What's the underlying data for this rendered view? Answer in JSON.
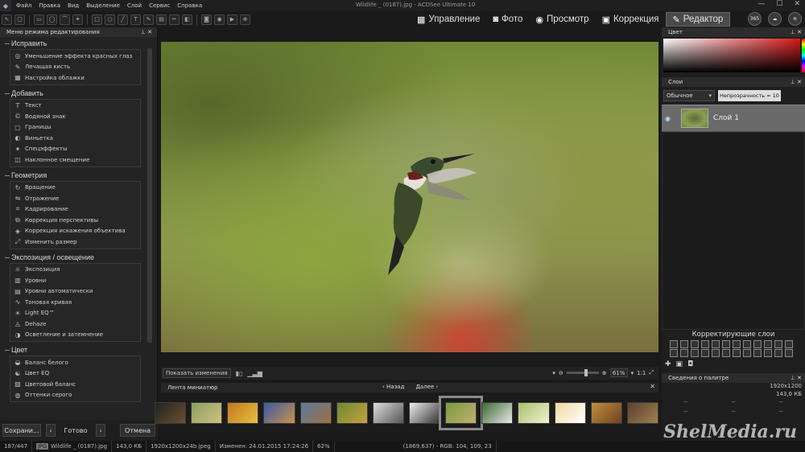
{
  "app": {
    "menus": [
      "Файл",
      "Правка",
      "Вид",
      "Выделение",
      "Слой",
      "Сервис",
      "Справка"
    ],
    "window_title": "Wildlife _ (0187).jpg - ACDSee Ultimate 10",
    "controls": [
      "—",
      "☐",
      "✕"
    ]
  },
  "modes": [
    {
      "label": "Управление",
      "icon": "grid-icon"
    },
    {
      "label": "Фото",
      "icon": "photo-icon"
    },
    {
      "label": "Просмотр",
      "icon": "eye-icon"
    },
    {
      "label": "Коррекция",
      "icon": "develop-icon"
    },
    {
      "label": "Редактор",
      "icon": "edit-icon",
      "active": true
    }
  ],
  "mode_icons": {
    "days": "365"
  },
  "left_panel": {
    "title": "Меню режима редактирования",
    "sections": [
      {
        "title": "Исправить",
        "items": [
          "Уменьшение эффекта красных глаз",
          "Лечащая кисть",
          "Настройка облажки"
        ]
      },
      {
        "title": "Добавить",
        "items": [
          "Текст",
          "Водяной знак",
          "Границы",
          "Виньетка",
          "Спецэффекты",
          "Наклонное смещение"
        ]
      },
      {
        "title": "Геометрия",
        "items": [
          "Вращение",
          "Отражение",
          "Кадрирование",
          "Коррекция перспективы",
          "Коррекция искажения объектива",
          "Изменить размер"
        ]
      },
      {
        "title": "Экспозиция / освещение",
        "items": [
          "Экспозиция",
          "Уровни",
          "Уровни автоматически",
          "Тоновая кривая",
          "Light EQ™",
          "Dehaze",
          "Осветление и затемнение"
        ]
      },
      {
        "title": "Цвет",
        "items": [
          "Баланс белого",
          "Цвет EQ",
          "Цветовой баланс",
          "Оттенки серого"
        ]
      }
    ],
    "buttons": {
      "save": "Сохрани...",
      "done": "Готово",
      "cancel": "Отмена"
    }
  },
  "viewer": {
    "show_changes": "Показать изменения",
    "zoom": "61%",
    "ratio": "1:1"
  },
  "filmstrip": {
    "title": "Лента миниатюр",
    "back": "Назад",
    "next": "Далее",
    "thumbs": [
      {
        "colors": [
          "#222",
          "#6a5030"
        ]
      },
      {
        "colors": [
          "#8aa060",
          "#d0c080"
        ]
      },
      {
        "colors": [
          "#c07820",
          "#e8c040"
        ]
      },
      {
        "colors": [
          "#3a5aa0",
          "#c89050"
        ]
      },
      {
        "colors": [
          "#5a7aa0",
          "#a07040"
        ]
      },
      {
        "colors": [
          "#6a8a30",
          "#c8a040"
        ]
      },
      {
        "colors": [
          "#ddd",
          "#555"
        ]
      },
      {
        "colors": [
          "#eee",
          "#333"
        ]
      },
      {
        "colors": [
          "#7a9a40",
          "#c0b070"
        ],
        "selected": true
      },
      {
        "colors": [
          "#3a6a30",
          "#e8e8e8"
        ]
      },
      {
        "colors": [
          "#a8c070",
          "#f0f0d0"
        ]
      },
      {
        "colors": [
          "#f0d8a0",
          "#fff"
        ]
      },
      {
        "colors": [
          "#c09040",
          "#704020"
        ]
      },
      {
        "colors": [
          "#5a4030",
          "#a08050"
        ]
      }
    ]
  },
  "right_panel": {
    "color_title": "Цвет",
    "layers_title": "Слои",
    "blend_mode": "Обычное",
    "opacity": "Непрозрачность = 10",
    "layer_name": "Слой 1",
    "adjust_title": "Корректирующие слои",
    "palette_title": "Сведения о палитре",
    "palette_dims": "1920x1200",
    "palette_size": "143,0 КБ",
    "palette_cells": [
      "--",
      "--",
      "--",
      "--",
      "--",
      "--"
    ]
  },
  "statusbar": {
    "count": "187/447",
    "type": "JPG",
    "filename": "Wildlife _ (0187).jpg",
    "size": "143,0 КБ",
    "dims": "1920x1200x24b jpeg",
    "modified": "Изменен: 24.01.2015 17:24:26",
    "zoom": "62%",
    "rgb": "(1869,637) - RGB: 104, 109, 23"
  },
  "watermark": "ShelMedia.ru"
}
